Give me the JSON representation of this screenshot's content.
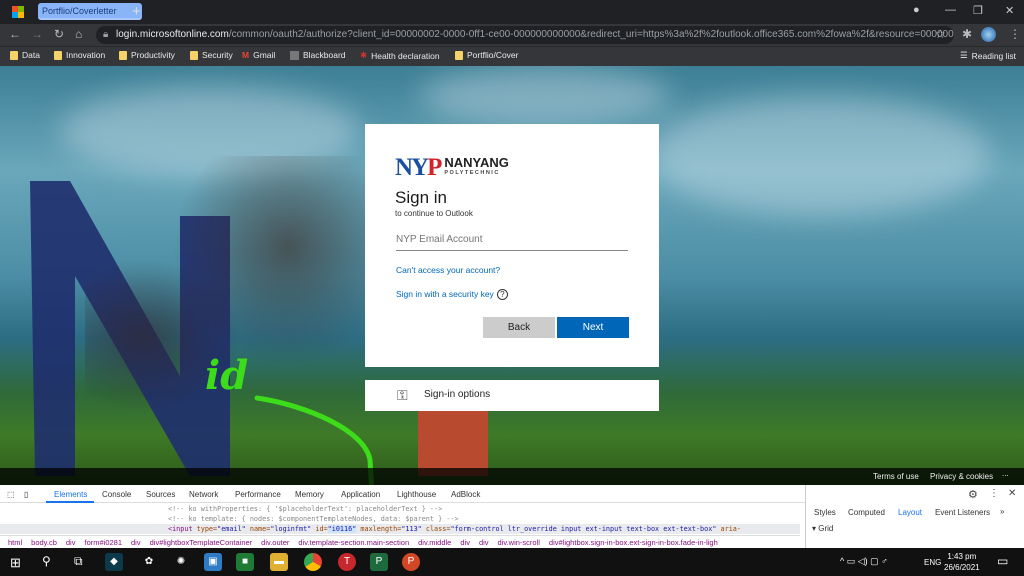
{
  "browser": {
    "tab_title": "Portflio/Coverletter",
    "new_tab": "+",
    "url_host": "login.microsoftonline.com",
    "url_rest": "/common/oauth2/authorize?client_id=00000002-0000-0ff1-ce00-000000000000&redirect_uri=https%3a%2f%2foutlook.office365.com%2fowa%2f&resource=00000002-...",
    "bookmarks": [
      "Data",
      "Innovation",
      "Productivity",
      "Security",
      "Gmail",
      "Blackboard",
      "Health declaration",
      "Portflio/Cover"
    ],
    "reading_list": "Reading list"
  },
  "signin": {
    "logo": "NYP NANYANG POLYTECHNIC",
    "logo_short": "NYP",
    "logo_name": "NANYANG",
    "logo_sub": "POLYTECHNIC",
    "title": "Sign in",
    "subtitle": "to continue to Outlook",
    "email_placeholder": "NYP Email Account",
    "cant_access": "Can't access your account?",
    "security_key": "Sign in with a security key",
    "help": "?",
    "back": "Back",
    "next": "Next",
    "options": "Sign-in options"
  },
  "footer": {
    "terms": "Terms of use",
    "privacy": "Privacy & cookies",
    "more": "..."
  },
  "annotation": {
    "text": "id",
    "color": "#3ddc1a"
  },
  "devtools": {
    "tabs": [
      "Elements",
      "Console",
      "Sources",
      "Network",
      "Performance",
      "Memory",
      "Application",
      "Lighthouse",
      "AdBlock"
    ],
    "code": {
      "line1": "<!-- ko withProperties: { '$placeholderText': placeholderText } -->",
      "line2": "<!-- ko template: { nodes: $componentTemplateNodes, data: $parent } -->",
      "l3_open": "<input ",
      "l3_a1": "type=",
      "l3_v1": "\"email\"",
      "l3_a2": " name=",
      "l3_v2": "\"loginfmt\"",
      "l3_a3": " id=",
      "l3_v3": "\"i0116\"",
      "l3_a4": " maxlength=",
      "l3_v4": "\"113\"",
      "l3_a5": " class=",
      "l3_v5": "\"form-control ltr_override input ext-input text-box ext-text-box\"",
      "l3_a6": " aria-"
    },
    "breadcrumb": [
      "html",
      "body.cb",
      "div",
      "form#i0281",
      "div",
      "div#lightboxTemplateContainer",
      "div.outer",
      "div.template-section.main-section",
      "div.middle",
      "div",
      "div",
      "div.win-scroll",
      "div#lightbox.sign-in-box.ext-sign-in-box.fade-in-ligh"
    ],
    "side_tabs": [
      "Styles",
      "Computed",
      "Layout",
      "Event Listeners"
    ],
    "side_section": "Grid"
  },
  "taskbar": {
    "lang": "ENG",
    "time": "1:43 pm",
    "date": "26/6/2021"
  }
}
